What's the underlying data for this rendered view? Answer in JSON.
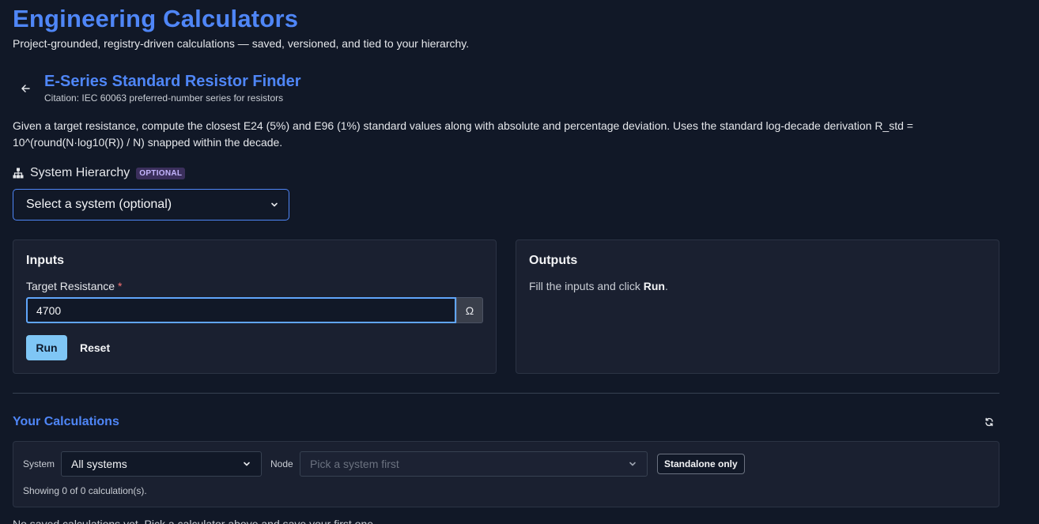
{
  "header": {
    "title": "Engineering Calculators",
    "subtitle": "Project-grounded, registry-driven calculations — saved, versioned, and tied to your hierarchy."
  },
  "calculator": {
    "back_icon": "arrow-left-icon",
    "title": "E-Series Standard Resistor Finder",
    "citation": "Citation: IEC 60063 preferred-number series for resistors",
    "description": "Given a target resistance, compute the closest E24 (5%) and E96 (1%) standard values along with absolute and percentage deviation. Uses the standard log-decade derivation R_std = 10^(round(N·log10(R)) / N) snapped within the decade."
  },
  "hierarchy": {
    "icon": "sitemap-icon",
    "label": "System Hierarchy",
    "badge": "OPTIONAL",
    "select_value": "Select a system (optional)"
  },
  "inputs": {
    "title": "Inputs",
    "field_label": "Target Resistance",
    "required_marker": "*",
    "field_value": "4700",
    "unit": "Ω",
    "run_label": "Run",
    "reset_label": "Reset"
  },
  "outputs": {
    "title": "Outputs",
    "message_prefix": "Fill the inputs and click ",
    "message_strong": "Run",
    "message_suffix": "."
  },
  "history": {
    "title": "Your Calculations",
    "refresh_icon": "refresh-icon",
    "system_label": "System",
    "system_value": "All systems",
    "node_label": "Node",
    "node_placeholder": "Pick a system first",
    "standalone_label": "Standalone only",
    "showing": "Showing 0 of 0 calculation(s).",
    "empty": "No saved calculations yet. Pick a calculator above and save your first one."
  },
  "colors": {
    "accent": "#4f86f7",
    "run_button": "#7fc6f5",
    "background": "#111827",
    "card": "#1a2030"
  }
}
